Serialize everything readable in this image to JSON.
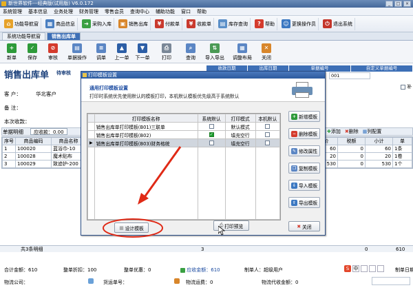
{
  "window": {
    "title": "新世界软件---经典版(试用版) V6.0.172"
  },
  "menu": [
    "系统管理",
    "基本信息",
    "业务处理",
    "财务管理",
    "零售会员",
    "查询中心",
    "辅助功能",
    "窗口",
    "帮助"
  ],
  "main_toolbar": [
    "功能导航窗",
    "商品信息",
    "采购入库",
    "销售出库",
    "付款单",
    "收款单",
    "库存查询",
    "帮助",
    "更换操作员",
    "退出系统"
  ],
  "tabs": [
    "系统功能导航窗",
    "销售出库单"
  ],
  "sub_toolbar": [
    "新单",
    "保存",
    "审核",
    "单据操作",
    "调单",
    "上一单",
    "下一单",
    "打印",
    "查询",
    "导入导出",
    "调整布局",
    "关闭"
  ],
  "doc": {
    "title": "销售出库单",
    "status": "待审核",
    "header_cols": [
      "收款日期",
      "出库日期",
      "单据编号",
      "自定义单据编号"
    ],
    "doc_no_fragment": "001",
    "customer_label": "客  户：",
    "customer_value": "华北客户",
    "remark_label": "备  注：",
    "this_collect_label": "本次收款：",
    "detail_label": "单据明细",
    "receivable_label": "应收款：",
    "receivable_value": "0.00",
    "supplement_label": "补",
    "grid_actions": [
      "添加",
      "删除",
      "列配置"
    ],
    "columns": [
      "序号",
      "商品编码",
      "商品名称"
    ],
    "columns_right": [
      "单价",
      "税额",
      "小计",
      "单"
    ],
    "rows": [
      {
        "no": "1",
        "code": "100020",
        "name": "蓝浴巾-10",
        "price": "60",
        "tax": "0",
        "subtotal": "60",
        "unit": "1条"
      },
      {
        "no": "2",
        "code": "100028",
        "name": "魔术贴布",
        "price": "20",
        "tax": "0",
        "subtotal": "20",
        "unit": "1卷"
      },
      {
        "no": "3",
        "code": "100029",
        "name": "致迹护-200",
        "price": "530",
        "tax": "0",
        "subtotal": "530",
        "unit": "1个"
      }
    ],
    "status_bar": {
      "left": "共3条明细",
      "count": "3",
      "zero": "0",
      "total": "610"
    }
  },
  "footer": {
    "total_label": "合计金额：",
    "total_value": "610",
    "discount_label": "整单折扣：",
    "discount_value": "100",
    "concession_label": "整单优惠：",
    "concession_value": "0",
    "receivable_label": "应收金额：",
    "receivable_value": "610",
    "maker_label": "制单人：",
    "maker_value": "超级用户",
    "make_date_label": "制单日期",
    "logistics_label": "物流公司：",
    "cargo_label": "货运单号：",
    "freight_label": "物流运费：",
    "freight_value": "0",
    "cod_label": "物流代收金额：",
    "cod_value": "0"
  },
  "dialog": {
    "title": "打印模板设置",
    "heading": "通用打印模板设置",
    "description": "打印时系统优先使用默认的模板打印，本机默认模板优先级高于系统默认",
    "columns": [
      "打印模板名称",
      "系统默认",
      "打印模式",
      "本机默认"
    ],
    "templates": [
      {
        "name": "销售出库单打印模板(B01)三联单",
        "sys_default": false,
        "mode": "默认模式",
        "local_default": false
      },
      {
        "name": "销售出库单打印模板(B02)",
        "sys_default": true,
        "mode": "填充空行",
        "local_default": false
      },
      {
        "name": "销售出库单打印模板(B03)财务格统",
        "sys_default": false,
        "mode": "填充空行",
        "local_default": false
      }
    ],
    "side_buttons": [
      "新增模板",
      "删除模板",
      "修改属性",
      "复制模板",
      "导入模板",
      "导出模板"
    ],
    "design_button": "设计模板",
    "preview_button": "打印预览",
    "close_button": "关闭"
  },
  "colors": {
    "accent": "#3d6fb6",
    "title_blue": "#1a3f7a",
    "highlight_circle": "#e03020",
    "arrow": "#e02a16"
  }
}
